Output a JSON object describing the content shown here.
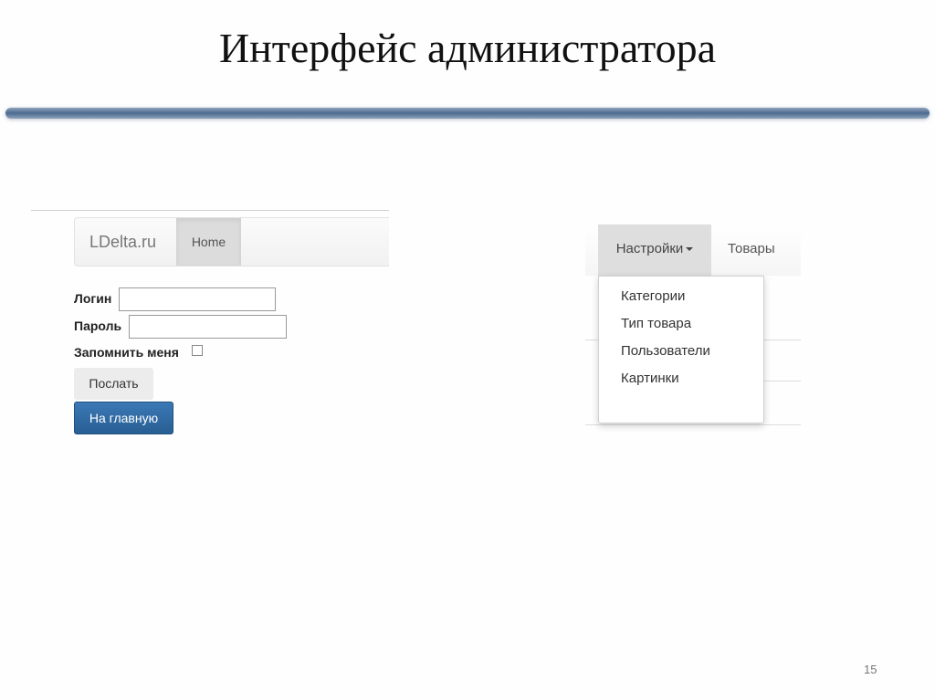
{
  "slide": {
    "title": "Интерфейс администратора",
    "page_number": "15",
    "accent_color": "#4c6a8f"
  },
  "login": {
    "brand": "LDelta.ru",
    "nav_home": "Home",
    "login_label": "Логин",
    "password_label": "Пароль",
    "remember_label": "Запомнить меня",
    "remember_checked": false,
    "send_button": "Послать",
    "home_button": "На главную",
    "home_button_color": "#2d6aa3"
  },
  "menu": {
    "settings_label": "Настройки",
    "goods_label": "Товары",
    "dropdown_items": [
      "Категории",
      "Тип товара",
      "Пользователи",
      "Картинки"
    ]
  }
}
